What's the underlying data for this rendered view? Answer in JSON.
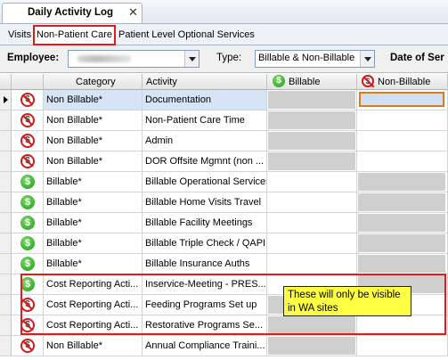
{
  "window": {
    "tab_title": "Daily Activity Log",
    "close_glyph": "✕"
  },
  "subtabs": [
    "Visits",
    "Non-Patient Care",
    "Patient Level Optional Services"
  ],
  "filters": {
    "employee_label": "Employee:",
    "type_label": "Type:",
    "type_value": "Billable & Non-Billable",
    "date_label": "Date of Ser"
  },
  "grid": {
    "headers": {
      "category": "Category",
      "activity": "Activity",
      "billable": "Billable",
      "non_billable": "Non-Billable"
    },
    "rows": [
      {
        "icon": "non-billable-icon",
        "category": "Non Billable*",
        "activity": "Documentation"
      },
      {
        "icon": "non-billable-icon",
        "category": "Non Billable*",
        "activity": "Non-Patient Care Time"
      },
      {
        "icon": "non-billable-icon",
        "category": "Non Billable*",
        "activity": "Admin"
      },
      {
        "icon": "non-billable-icon",
        "category": "Non Billable*",
        "activity": "DOR Offsite Mgmnt (non ..."
      },
      {
        "icon": "billable-icon",
        "category": "Billable*",
        "activity": "Billable Operational Services"
      },
      {
        "icon": "billable-icon",
        "category": "Billable*",
        "activity": "Billable Home Visits Travel"
      },
      {
        "icon": "billable-icon",
        "category": "Billable*",
        "activity": "Billable Facility Meetings"
      },
      {
        "icon": "billable-icon",
        "category": "Billable*",
        "activity": "Billable Triple Check / QAPI"
      },
      {
        "icon": "billable-icon",
        "category": "Billable*",
        "activity": "Billable Insurance Auths"
      },
      {
        "icon": "billable-icon",
        "category": "Cost Reporting Acti...",
        "activity": "Inservice-Meeting - PRES..."
      },
      {
        "icon": "non-billable-icon",
        "category": "Cost Reporting Acti...",
        "activity": "Feeding Programs Set up"
      },
      {
        "icon": "non-billable-icon",
        "category": "Cost Reporting Acti...",
        "activity": "Restorative Programs Se..."
      },
      {
        "icon": "non-billable-icon",
        "category": "Non Billable*",
        "activity": "Annual Compliance Traini..."
      }
    ]
  },
  "annotation": "These will only be visible in WA sites",
  "colors": {
    "highlight": "#e01b1b",
    "note_bg": "#ffff44",
    "billable_green": "#1e9a16"
  }
}
